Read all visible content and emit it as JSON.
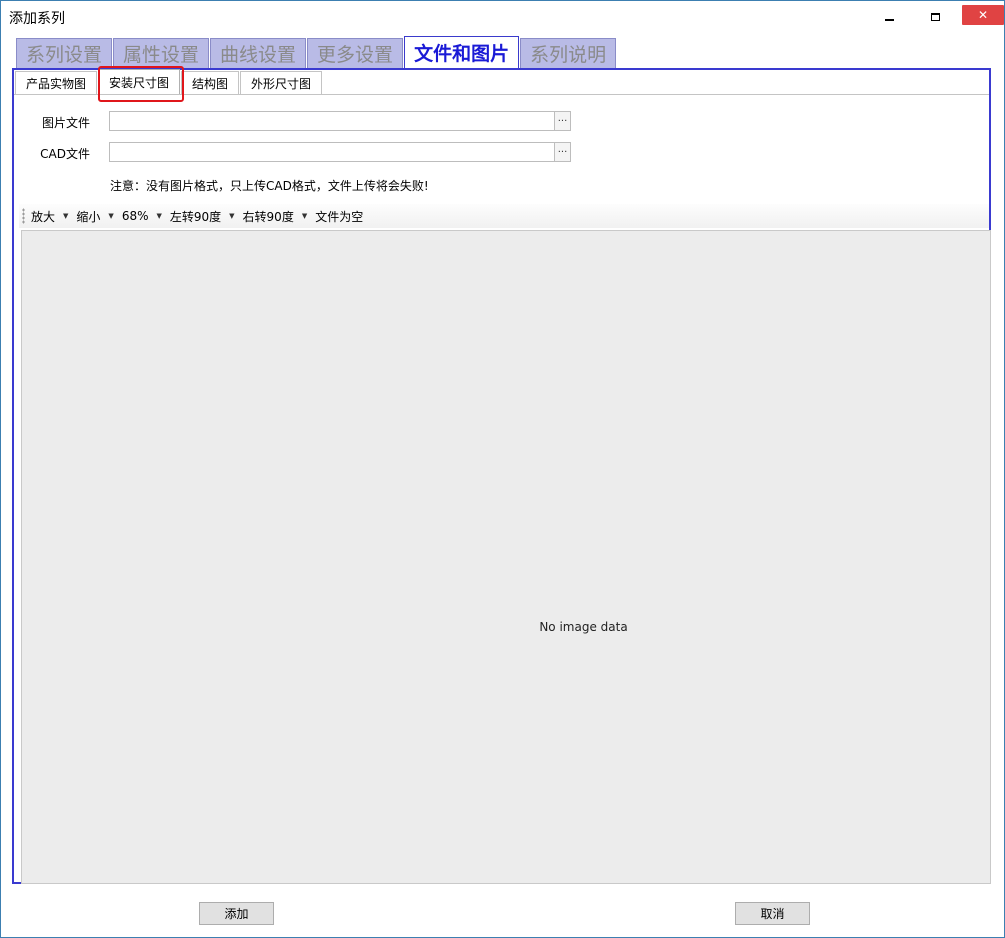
{
  "window": {
    "title": "添加系列",
    "minimize_icon": "minimize-icon",
    "maximize_icon": "maximize-icon",
    "close_icon": "close-icon",
    "close_symbol": "✕"
  },
  "main_tabs": [
    {
      "label": "系列设置",
      "active": false
    },
    {
      "label": "属性设置",
      "active": false
    },
    {
      "label": "曲线设置",
      "active": false
    },
    {
      "label": "更多设置",
      "active": false
    },
    {
      "label": "文件和图片",
      "active": true
    },
    {
      "label": "系列说明",
      "active": false
    }
  ],
  "sub_tabs": [
    {
      "label": "产品实物图",
      "active": false
    },
    {
      "label": "安装尺寸图",
      "active": true
    },
    {
      "label": "结构图",
      "active": false
    },
    {
      "label": "外形尺寸图",
      "active": false
    }
  ],
  "fields": {
    "image_file": {
      "label": "图片文件",
      "value": "",
      "browse_label": "···"
    },
    "cad_file": {
      "label": "CAD文件",
      "value": "",
      "browse_label": "···"
    }
  },
  "note": "注意：没有图片格式，只上传CAD格式，文件上传将会失败!",
  "toolbar": {
    "zoom_in": "放大",
    "zoom_out": "缩小",
    "zoom_level": "68%",
    "rotate_left": "左转90度",
    "rotate_right": "右转90度",
    "status": "文件为空",
    "dropdown_icon": "▼"
  },
  "image_area": {
    "empty_text": "No image data"
  },
  "buttons": {
    "add": "添加",
    "cancel": "取消"
  },
  "colors": {
    "active_tab_text": "#1a1ad6",
    "inactive_tab_bg": "#b9bbe6",
    "panel_border": "#3a3ad0",
    "highlight": "#e0161b",
    "close_button": "#e04343"
  }
}
